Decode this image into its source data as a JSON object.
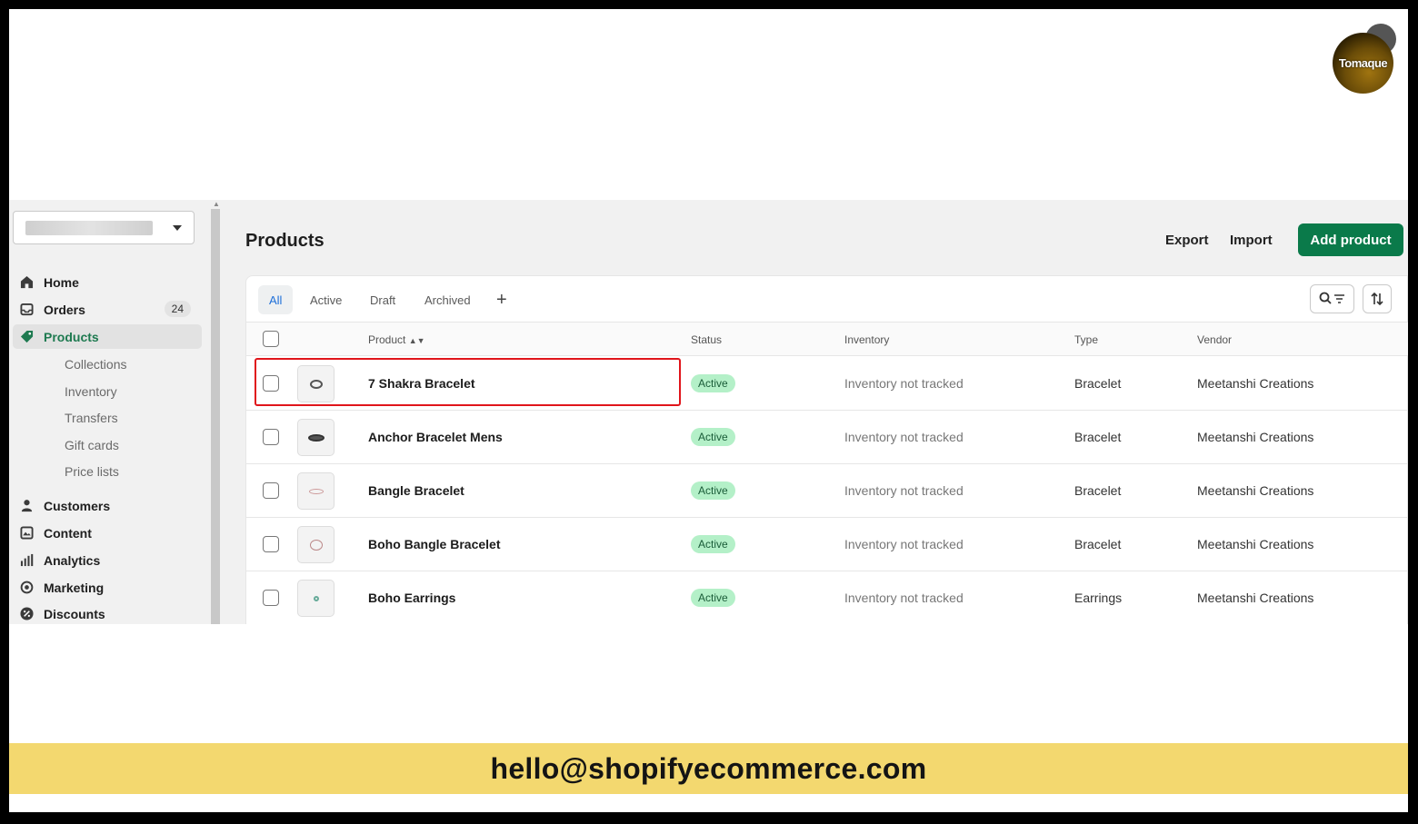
{
  "logo": {
    "text": "Tomaque"
  },
  "sidebar": {
    "items": [
      {
        "label": "Home",
        "icon": "home-icon"
      },
      {
        "label": "Orders",
        "icon": "orders-icon",
        "badge": "24"
      },
      {
        "label": "Products",
        "icon": "tag-icon",
        "active": true
      },
      {
        "label": "Collections",
        "sub": true
      },
      {
        "label": "Inventory",
        "sub": true
      },
      {
        "label": "Transfers",
        "sub": true
      },
      {
        "label": "Gift cards",
        "sub": true
      },
      {
        "label": "Price lists",
        "sub": true
      },
      {
        "label": "Customers",
        "icon": "person-icon"
      },
      {
        "label": "Content",
        "icon": "content-icon"
      },
      {
        "label": "Analytics",
        "icon": "bar-chart-icon"
      },
      {
        "label": "Marketing",
        "icon": "target-icon"
      },
      {
        "label": "Discounts",
        "icon": "discount-icon"
      }
    ]
  },
  "header": {
    "title": "Products",
    "export_label": "Export",
    "import_label": "Import",
    "add_label": "Add product"
  },
  "tabs": [
    "All",
    "Active",
    "Draft",
    "Archived"
  ],
  "table": {
    "columns": {
      "product": "Product",
      "status": "Status",
      "inventory": "Inventory",
      "type": "Type",
      "vendor": "Vendor"
    },
    "rows": [
      {
        "name": "7 Shakra Bracelet",
        "status": "Active",
        "inventory": "Inventory not tracked",
        "type": "Bracelet",
        "vendor": "Meetanshi Creations"
      },
      {
        "name": "Anchor Bracelet Mens",
        "status": "Active",
        "inventory": "Inventory not tracked",
        "type": "Bracelet",
        "vendor": "Meetanshi Creations"
      },
      {
        "name": "Bangle Bracelet",
        "status": "Active",
        "inventory": "Inventory not tracked",
        "type": "Bracelet",
        "vendor": "Meetanshi Creations"
      },
      {
        "name": "Boho Bangle Bracelet",
        "status": "Active",
        "inventory": "Inventory not tracked",
        "type": "Bracelet",
        "vendor": "Meetanshi Creations"
      },
      {
        "name": "Boho Earrings",
        "status": "Active",
        "inventory": "Inventory not tracked",
        "type": "Earrings",
        "vendor": "Meetanshi Creations"
      }
    ]
  },
  "colors": {
    "accent": "#0a7a4a",
    "highlight": "#e0151b",
    "banner": "#f3d86f"
  },
  "banner": {
    "email": "hello@shopifyecommerce.com"
  }
}
